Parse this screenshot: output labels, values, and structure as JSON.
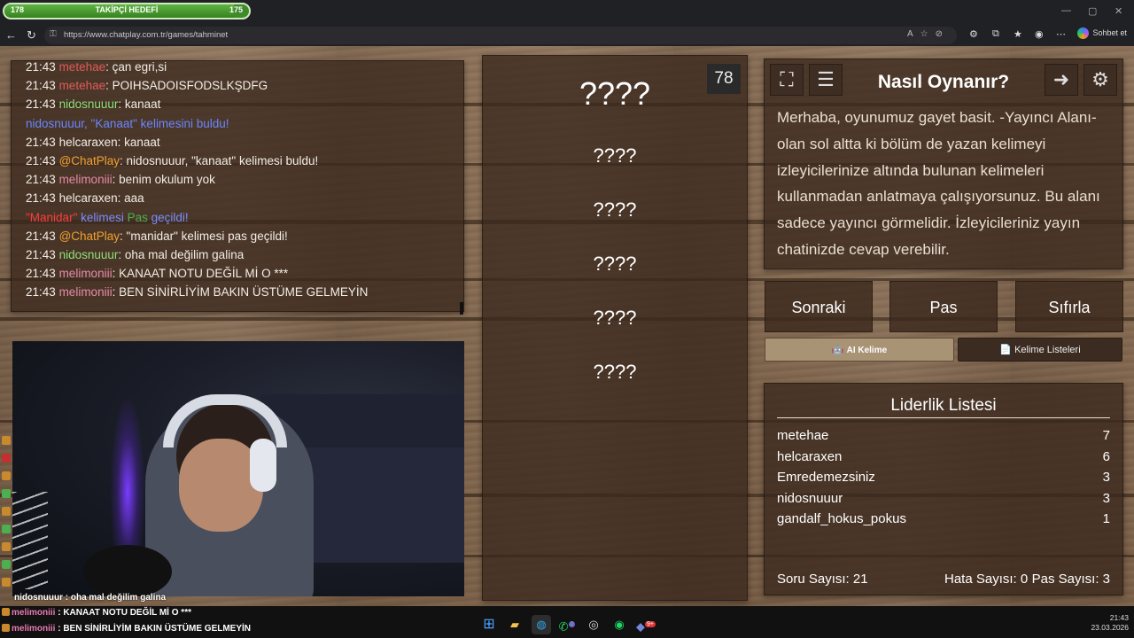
{
  "goal_bar": {
    "left": "178",
    "title": "TAKİPÇİ HEDEFİ",
    "right": "175",
    "progress": 0.94
  },
  "browser": {
    "url": "https://www.chatplay.com.tr/games/tahminet",
    "copilot_label": "Sohbet et"
  },
  "chat": {
    "lines": [
      {
        "time": "21:43",
        "user": "metehae",
        "user_color": "#e05a5a",
        "text": ": çan egri,si"
      },
      {
        "time": "21:43",
        "user": "metehae",
        "user_color": "#e05a5a",
        "text": ": POIHSADOISFODSLKŞDFG"
      },
      {
        "time": "21:43",
        "user": "nidosnuuur",
        "user_color": "#8fe07a",
        "text": ": kanaat"
      },
      {
        "time": "",
        "user": "",
        "user_color": "#5e7cff",
        "text": "nidosnuuur, \"Kanaat\" kelimesini buldu!",
        "text_color": "#6a86ff"
      },
      {
        "time": "21:43",
        "user": "helcaraxen",
        "user_color": "#f2ede6",
        "text": ": kanaat"
      },
      {
        "time": "21:43",
        "user": "@ChatPlay",
        "user_color": "#f0a030",
        "text": ": nidosnuuur, \"kanaat\" kelimesi buldu!"
      },
      {
        "time": "21:43",
        "user": "melimoniii",
        "user_color": "#e58aa8",
        "text": ": benim okulum yok"
      },
      {
        "time": "21:43",
        "user": "helcaraxen",
        "user_color": "#f2ede6",
        "text": ": aaa"
      },
      {
        "time": "",
        "user": "\"Manidar\"",
        "user_color": "#ff3b3b",
        "text": " kelimesi ",
        "text_color": "#7a8cff",
        "extra": "Pas",
        "extra_color": "#4caf50",
        "tail": " geçildi!",
        "tail_color": "#7a8cff"
      },
      {
        "time": "21:43",
        "user": "@ChatPlay",
        "user_color": "#f0a030",
        "text": ": \"manidar\" kelimesi pas geçildi!"
      },
      {
        "time": "21:43",
        "user": "nidosnuuur",
        "user_color": "#8fe07a",
        "text": ": oha mal değilim galina"
      },
      {
        "time": "21:43",
        "user": "melimoniii",
        "user_color": "#e58aa8",
        "text": ": KANAAT NOTU DEĞİL Mİ O ***"
      },
      {
        "time": "21:43",
        "user": "melimoniii",
        "user_color": "#e58aa8",
        "text": ": BEN SİNİRLİYİM BAKIN ÜSTÜME GELMEYİN"
      }
    ]
  },
  "webcam_overlay": "nidosnuuur : oha mal değilim galina",
  "words": [
    "????",
    "????",
    "????",
    "????",
    "????",
    "????"
  ],
  "counter": "78",
  "howto": {
    "title": "Nasıl Oynanır?",
    "text": "Merhaba, oyunumuz gayet basit. -Yayıncı Alanı- olan sol altta ki bölüm de yazan kelimeyi izleyicilerinize altında bulunan kelimeleri kullanmadan anlatmaya çalışıyorsunuz. Bu alanı sadece yayıncı görmelidir. İzleyicileriniz yayın chatinizde cevap verebilir."
  },
  "buttons": {
    "next": "Sonraki",
    "pass": "Pas",
    "reset": "Sıfırla",
    "ai_word": "AI Kelime",
    "word_lists": "Kelime Listeleri"
  },
  "leaderboard": {
    "title": "Liderlik Listesi",
    "rows": [
      {
        "name": "metehae",
        "score": "7"
      },
      {
        "name": "helcaraxen",
        "score": "6"
      },
      {
        "name": "Emredemezsiniz",
        "score": "3"
      },
      {
        "name": "nidosnuuur",
        "score": "3"
      },
      {
        "name": "gandalf_hokus_pokus",
        "score": "1"
      }
    ],
    "question_count": "Soru Sayısı: 21",
    "error_count": "Hata Sayısı: 0",
    "pass_count": "Pas Sayısı: 3"
  },
  "bottom_chat": [
    {
      "user": "melimoniii",
      "text": " : KANAAT NOTU DEĞİL Mİ O ***"
    },
    {
      "user": "melimoniii",
      "text": " : BEN SİNİRLİYİM BAKIN ÜSTÜME GELMEYİN"
    }
  ],
  "clock": {
    "time": "21:43",
    "date": "23.03.2026"
  },
  "taskbar_badges": {
    "whatsapp": "2",
    "discord": "9+"
  },
  "colors": {
    "accent_green": "#3f8b2c",
    "panel": "#3a281c",
    "ai_button": "#a89375"
  }
}
